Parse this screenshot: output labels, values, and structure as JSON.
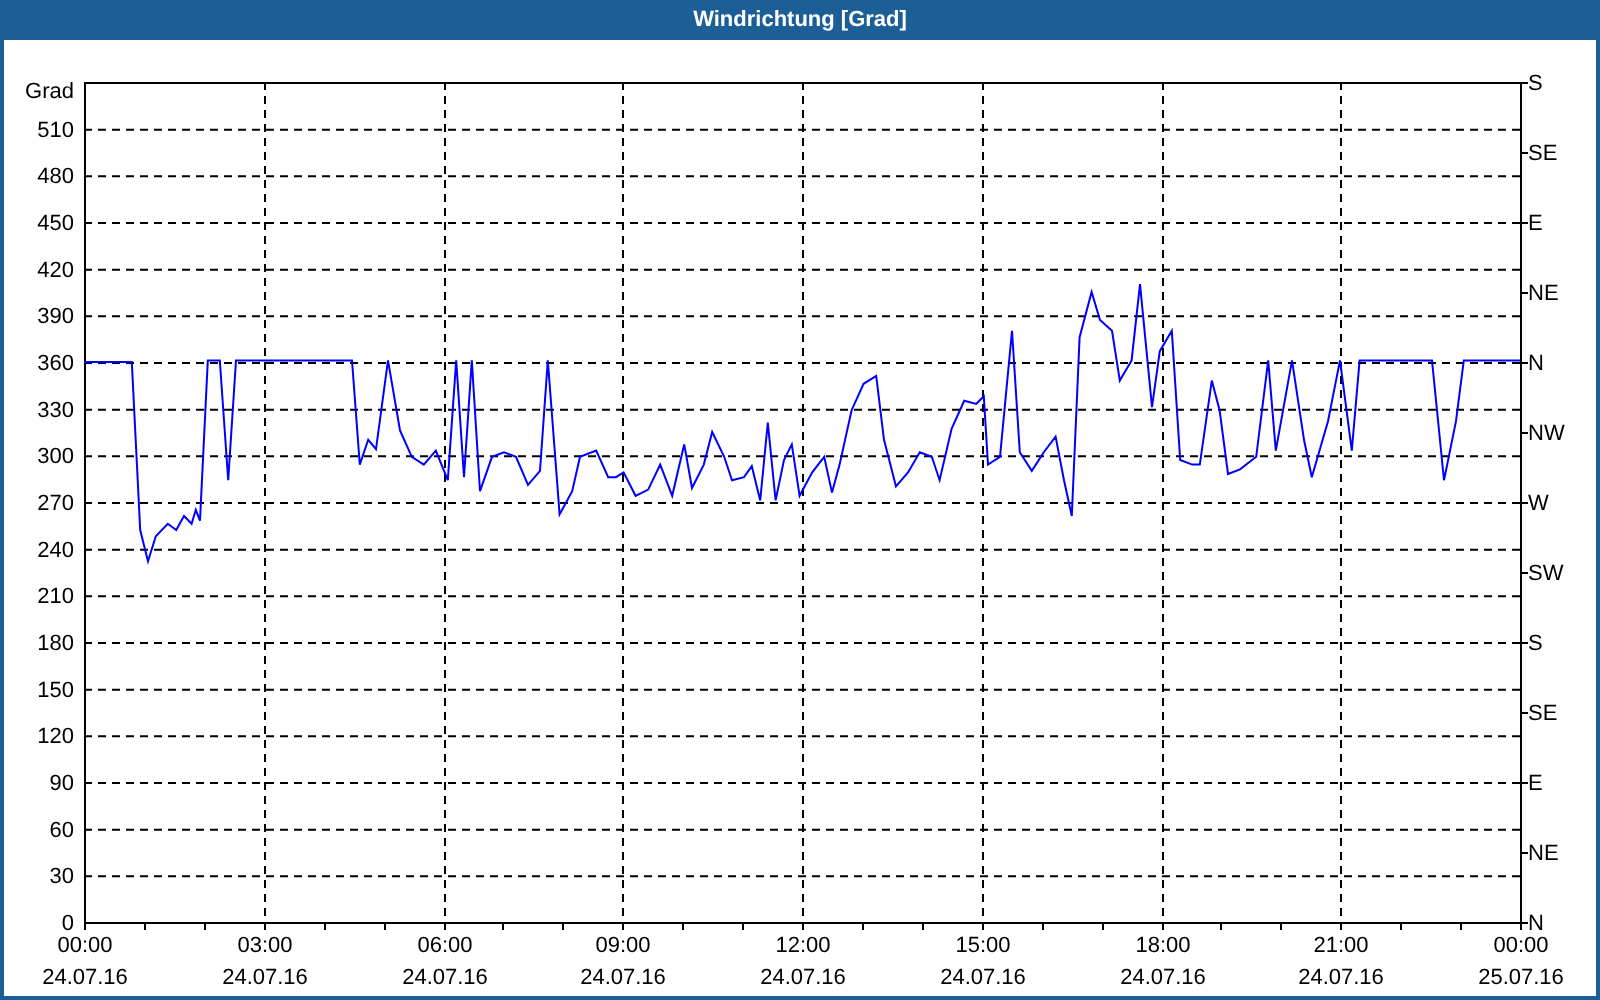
{
  "window": {
    "title": "Windrichtung [Grad]"
  },
  "chart": {
    "chart_data": {
      "type": "line",
      "grid": true,
      "ylabel": "Grad",
      "xlim": [
        0,
        24
      ],
      "ylim": [
        0,
        540
      ],
      "yticks": [
        0,
        30,
        60,
        90,
        120,
        150,
        180,
        210,
        240,
        270,
        300,
        330,
        360,
        390,
        420,
        450,
        480,
        510
      ],
      "xticks": [
        {
          "value": 0,
          "label": "00:00"
        },
        {
          "value": 3,
          "label": "03:00"
        },
        {
          "value": 6,
          "label": "06:00"
        },
        {
          "value": 9,
          "label": "09:00"
        },
        {
          "value": 12,
          "label": "12:00"
        },
        {
          "value": 15,
          "label": "15:00"
        },
        {
          "value": 18,
          "label": "18:00"
        },
        {
          "value": 21,
          "label": "21:00"
        },
        {
          "value": 24,
          "label": "00:00"
        }
      ],
      "x": [
        0,
        0.8,
        0.94,
        1.07,
        1.2,
        1.4,
        1.54,
        1.67,
        1.8,
        1.87,
        1.94,
        2.07,
        2.27,
        2.41,
        2.54,
        2.67,
        4.48,
        4.61,
        4.75,
        4.88,
        5.08,
        5.28,
        5.48,
        5.68,
        5.88,
        6.08,
        6.22,
        6.35,
        6.48,
        6.62,
        6.82,
        7.02,
        7.22,
        7.42,
        7.62,
        7.75,
        7.95,
        8.16,
        8.29,
        8.56,
        8.76,
        8.89,
        9.02,
        9.22,
        9.43,
        9.63,
        9.83,
        10.03,
        10.16,
        10.36,
        10.5,
        10.7,
        10.83,
        11.03,
        11.16,
        11.3,
        11.43,
        11.56,
        11.7,
        11.83,
        11.96,
        12.17,
        12.37,
        12.5,
        12.63,
        12.83,
        13.03,
        13.24,
        13.37,
        13.57,
        13.77,
        13.97,
        14.17,
        14.3,
        14.5,
        14.71,
        14.91,
        15.04,
        15.11,
        15.31,
        15.51,
        15.64,
        15.84,
        16.04,
        16.24,
        16.38,
        16.51,
        16.64,
        16.84,
        16.98,
        17.18,
        17.31,
        17.51,
        17.65,
        17.85,
        17.98,
        18.18,
        18.32,
        18.52,
        18.65,
        18.85,
        18.98,
        19.12,
        19.32,
        19.59,
        19.79,
        19.92,
        20.19,
        20.39,
        20.52,
        20.79,
        20.99,
        21.19,
        21.32,
        22.53,
        22.73,
        22.93,
        23.06,
        24
      ],
      "series": [
        {
          "color": "#0000ff",
          "values": [
            360,
            360,
            252,
            232,
            248,
            256,
            252,
            261,
            256,
            265,
            258,
            361,
            361,
            284,
            361,
            361,
            361,
            294,
            310,
            304,
            361,
            316,
            299,
            294,
            303,
            284,
            361,
            286,
            361,
            277,
            299,
            302,
            299,
            281,
            290,
            361,
            262,
            277,
            299,
            303,
            286,
            286,
            289,
            274,
            278,
            294,
            274,
            307,
            279,
            294,
            315,
            299,
            284,
            286,
            293,
            271,
            321,
            271,
            297,
            307,
            274,
            289,
            299,
            276,
            294,
            329,
            346,
            351,
            310,
            280,
            289,
            302,
            299,
            284,
            317,
            335,
            333,
            338,
            294,
            299,
            380,
            302,
            290,
            302,
            312,
            284,
            261,
            376,
            405,
            387,
            380,
            348,
            361,
            410,
            331,
            367,
            380,
            297,
            294,
            294,
            348,
            329,
            288,
            291,
            299,
            361,
            303,
            361,
            310,
            286,
            322,
            361,
            303,
            361,
            361,
            284,
            322,
            361,
            361
          ]
        }
      ]
    },
    "xtick_dates": [
      "24.07.16",
      "24.07.16",
      "24.07.16",
      "24.07.16",
      "24.07.16",
      "24.07.16",
      "24.07.16",
      "24.07.16",
      "25.07.16"
    ],
    "right_axis_labels": [
      "S",
      "SE",
      "E",
      "NE",
      "N",
      "NW",
      "W",
      "SW",
      "S",
      "SE",
      "E",
      "NE",
      "N"
    ]
  }
}
